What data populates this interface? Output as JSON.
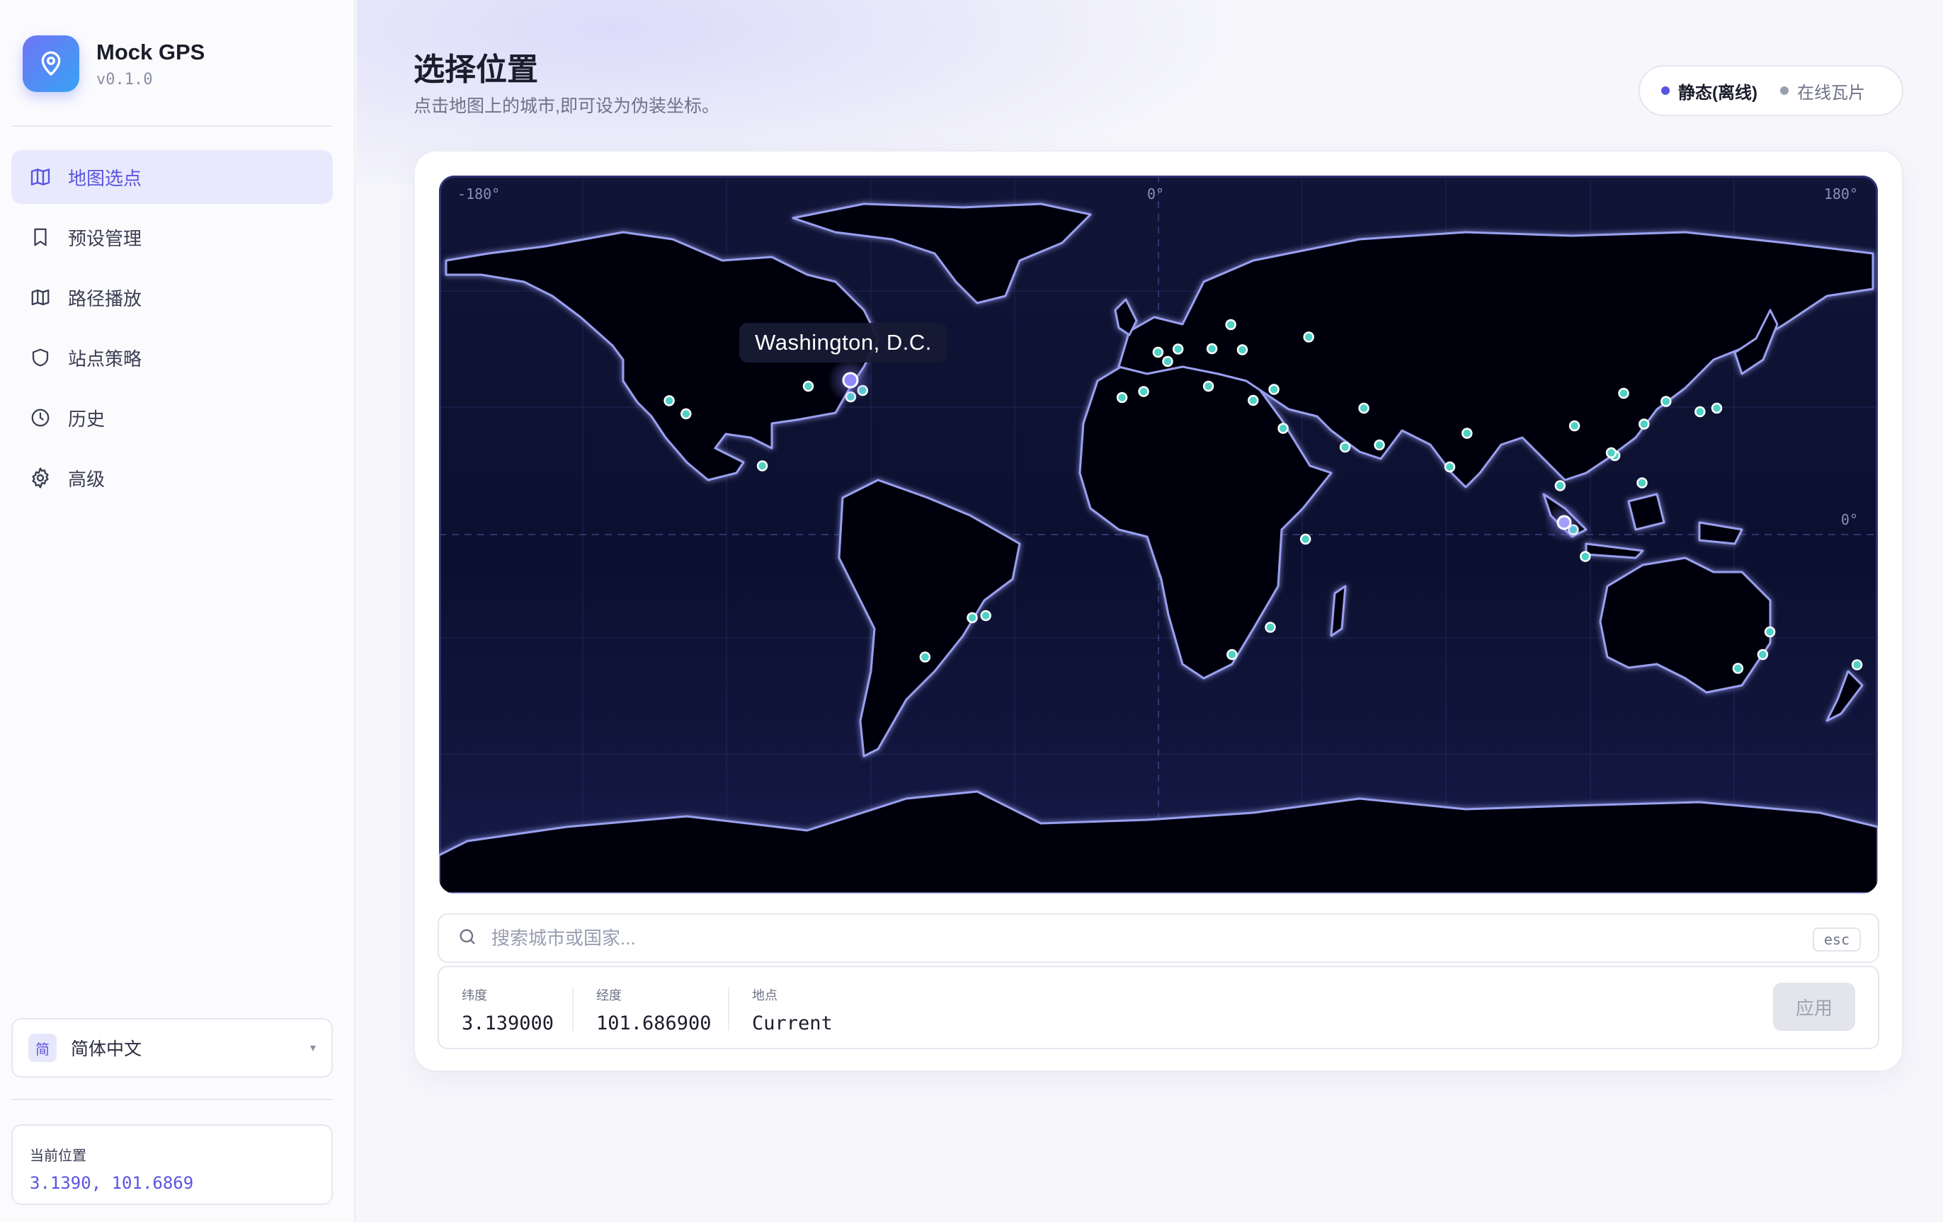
{
  "app": {
    "name": "Mock GPS",
    "version": "v0.1.0"
  },
  "nav": [
    {
      "label": "地图选点",
      "icon": "map-icon",
      "active": true
    },
    {
      "label": "预设管理",
      "icon": "bookmark-icon",
      "active": false
    },
    {
      "label": "路径播放",
      "icon": "route-map-icon",
      "active": false
    },
    {
      "label": "站点策略",
      "icon": "shield-icon",
      "active": false
    },
    {
      "label": "历史",
      "icon": "clock-icon",
      "active": false
    },
    {
      "label": "高级",
      "icon": "gear-icon",
      "active": false
    }
  ],
  "language": {
    "badge": "简",
    "label": "简体中文"
  },
  "current_position": {
    "label": "当前位置",
    "value": "3.1390, 101.6869"
  },
  "page": {
    "title": "选择位置",
    "subtitle": "点击地图上的城市,即可设为伪装坐标。"
  },
  "mode": {
    "active": "静态(离线)",
    "inactive": "在线瓦片"
  },
  "map": {
    "lon_left": "-180°",
    "lon_center": "0°",
    "lon_right": "180°",
    "lat_equator": "0°",
    "hovered_city": "Washington, D.C.",
    "selected": {
      "lat": 3.139,
      "lon": 101.6869
    },
    "city_markers": [
      [
        -122.4,
        37.8
      ],
      [
        -118.2,
        34.1
      ],
      [
        -99.1,
        19.4
      ],
      [
        -87.6,
        41.9
      ],
      [
        -77.0,
        38.9
      ],
      [
        -74.0,
        40.7
      ],
      [
        -43.2,
        -22.9
      ],
      [
        -46.6,
        -23.5
      ],
      [
        -58.4,
        -34.6
      ],
      [
        -0.1,
        51.5
      ],
      [
        2.3,
        48.9
      ],
      [
        -3.7,
        40.4
      ],
      [
        -9.1,
        38.7
      ],
      [
        12.5,
        41.9
      ],
      [
        13.4,
        52.5
      ],
      [
        4.9,
        52.4
      ],
      [
        18.1,
        59.3
      ],
      [
        21.0,
        52.2
      ],
      [
        37.6,
        55.8
      ],
      [
        28.9,
        41.0
      ],
      [
        23.7,
        37.9
      ],
      [
        31.2,
        30.0
      ],
      [
        36.8,
        -1.3
      ],
      [
        28.0,
        -26.2
      ],
      [
        18.4,
        -33.9
      ],
      [
        51.4,
        35.7
      ],
      [
        46.7,
        24.7
      ],
      [
        55.3,
        25.3
      ],
      [
        72.9,
        19.1
      ],
      [
        77.2,
        28.6
      ],
      [
        100.5,
        13.8
      ],
      [
        103.8,
        1.35
      ],
      [
        106.8,
        -6.2
      ],
      [
        116.4,
        39.9
      ],
      [
        121.5,
        31.2
      ],
      [
        114.2,
        22.3
      ],
      [
        113.3,
        23.1
      ],
      [
        104.1,
        30.7
      ],
      [
        121.0,
        14.6
      ],
      [
        127.0,
        37.6
      ],
      [
        135.5,
        34.7
      ],
      [
        139.7,
        35.7
      ],
      [
        151.2,
        -33.9
      ],
      [
        145.0,
        -37.8
      ],
      [
        153.0,
        -27.5
      ],
      [
        174.8,
        -36.8
      ]
    ]
  },
  "search": {
    "placeholder": "搜索城市或国家...",
    "esc": "esc"
  },
  "coords": {
    "lat_label": "纬度",
    "lat_value": "3.139000",
    "lon_label": "经度",
    "lon_value": "101.686900",
    "place_label": "地点",
    "place_value": "Current"
  },
  "apply_label": "应用",
  "colors": {
    "accent": "#5a55e0",
    "marker": "#4fd1c5",
    "map_bg": "#0e1233",
    "coastline": "#8f95e8"
  }
}
